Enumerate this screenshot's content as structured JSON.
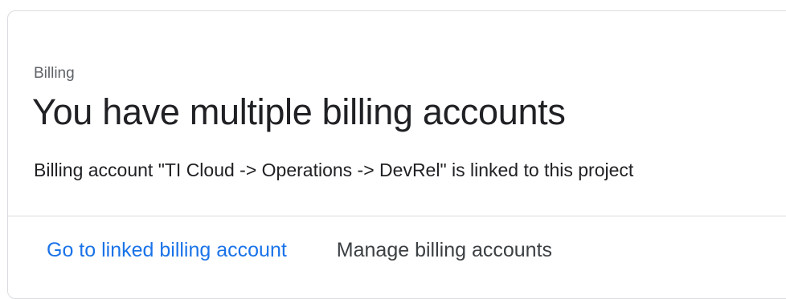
{
  "card": {
    "eyebrow": "Billing",
    "title": "You have multiple billing accounts",
    "description": "Billing account \"TI Cloud -> Operations -> DevRel\" is linked to this project"
  },
  "actions": {
    "primary_label": "Go to linked billing account",
    "secondary_label": "Manage billing accounts"
  },
  "colors": {
    "primary_link": "#1a73e8",
    "secondary_text": "#3c4043",
    "divider": "#dadce0"
  }
}
